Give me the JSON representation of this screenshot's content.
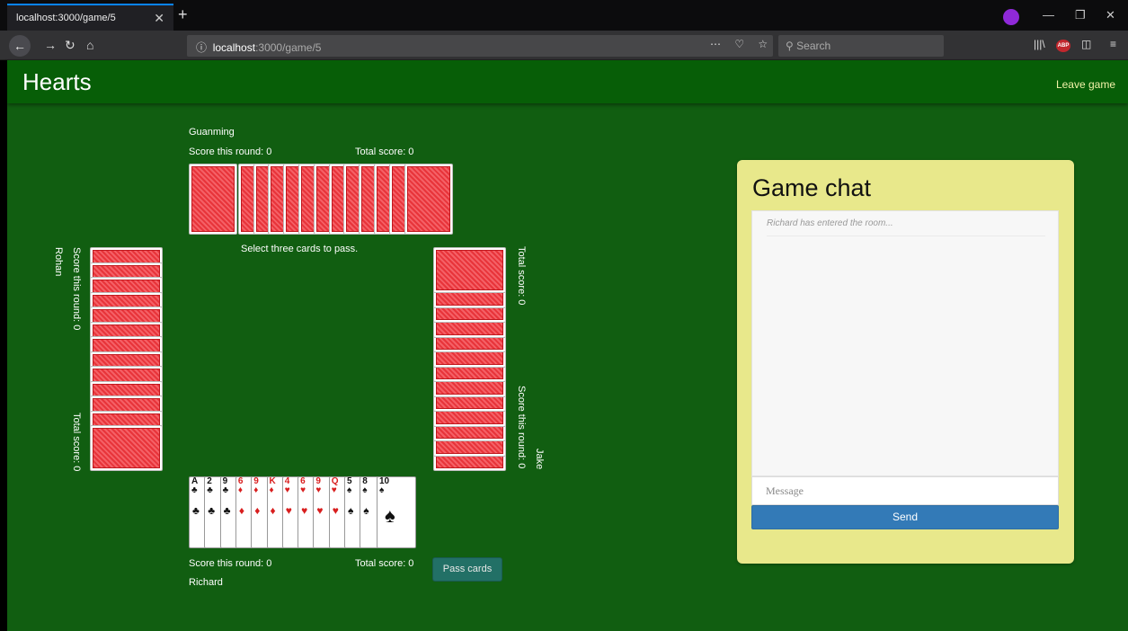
{
  "browser": {
    "tab_title": "localhost:3000/game/5",
    "url_host": "localhost",
    "url_path": ":3000/game/5",
    "search_placeholder": "Search"
  },
  "header": {
    "title": "Hearts",
    "leave_label": "Leave game"
  },
  "players": {
    "top": {
      "name": "Guanming",
      "round_score": "Score this round: 0",
      "total_score": "Total score: 0"
    },
    "left": {
      "name": "Rohan",
      "round_score": "Score this round: 0",
      "total_score": "Total score: 0"
    },
    "right": {
      "name": "Jake",
      "round_score": "Score this round: 0",
      "total_score": "Total score: 0"
    },
    "bottom": {
      "name": "Richard",
      "round_score": "Score this round: 0",
      "total_score": "Total score: 0"
    }
  },
  "table": {
    "instruction": "Select three cards to pass.",
    "pass_label": "Pass cards"
  },
  "hand": [
    {
      "rank": "A",
      "suit": "♣",
      "color": "#111111"
    },
    {
      "rank": "2",
      "suit": "♣",
      "color": "#111111"
    },
    {
      "rank": "9",
      "suit": "♣",
      "color": "#111111"
    },
    {
      "rank": "6",
      "suit": "♦",
      "color": "#d81e1e"
    },
    {
      "rank": "9",
      "suit": "♦",
      "color": "#d81e1e"
    },
    {
      "rank": "K",
      "suit": "♦",
      "color": "#d81e1e"
    },
    {
      "rank": "4",
      "suit": "♥",
      "color": "#d81e1e"
    },
    {
      "rank": "6",
      "suit": "♥",
      "color": "#d81e1e"
    },
    {
      "rank": "9",
      "suit": "♥",
      "color": "#d81e1e"
    },
    {
      "rank": "Q",
      "suit": "♥",
      "color": "#d81e1e"
    },
    {
      "rank": "5",
      "suit": "♠",
      "color": "#111111"
    },
    {
      "rank": "8",
      "suit": "♠",
      "color": "#111111"
    },
    {
      "rank": "10",
      "suit": "♠",
      "color": "#111111"
    }
  ],
  "chat": {
    "title": "Game chat",
    "messages": [
      "Richard has entered the room..."
    ],
    "input_placeholder": "Message",
    "send_label": "Send"
  }
}
